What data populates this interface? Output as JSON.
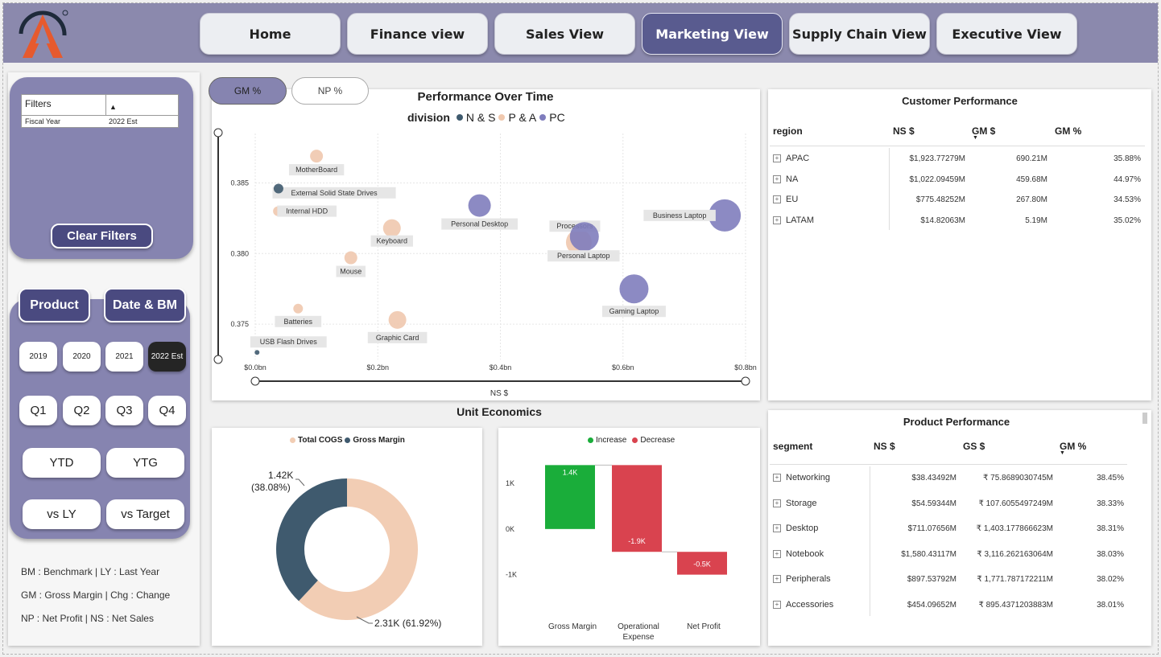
{
  "nav": {
    "items": [
      {
        "label": "Home",
        "active": false
      },
      {
        "label": "Finance view",
        "active": false
      },
      {
        "label": "Sales View",
        "active": false
      },
      {
        "label": "Marketing View",
        "active": true
      },
      {
        "label": "Supply Chain View",
        "active": false
      },
      {
        "label": "Executive View",
        "active": false
      }
    ]
  },
  "filters": {
    "header": "Filters",
    "row_label": "Fiscal Year",
    "row_value": "2022 Est",
    "clear_label": "Clear Filters"
  },
  "tabs": {
    "product": "Product",
    "date_bm": "Date & BM"
  },
  "years": [
    "2019",
    "2020",
    "2021",
    "2022 Est"
  ],
  "quarters": [
    "Q1",
    "Q2",
    "Q3",
    "Q4"
  ],
  "ytd": "YTD",
  "ytg": "YTG",
  "vs_ly": "vs LY",
  "vs_target": "vs Target",
  "legend_notes": [
    "BM : Benchmark | LY : Last Year",
    "GM : Gross Margin |  Chg : Change",
    "NP : Net Profit | NS : Net Sales"
  ],
  "metric_toggle": {
    "gm": "GM %",
    "np": "NP %"
  },
  "colors": {
    "ns": "#3f5a6e",
    "pa": "#f0c8ae",
    "pc": "#7f7dbd",
    "increase": "#1aad3a",
    "decrease": "#d9434f",
    "cogs": "#f2cdb4",
    "gm": "#3f5a6e",
    "accent": "#595b8f"
  },
  "chart_data": [
    {
      "type": "scatter",
      "title": "Performance Over Time",
      "legend_title": "division",
      "legend": [
        "N & S",
        "P & A",
        "PC"
      ],
      "xlabel": "NS $",
      "xlim": [
        0,
        0.8
      ],
      "ylim": [
        0.3725,
        0.3885
      ],
      "x_ticks": [
        "$0.0bn",
        "$0.2bn",
        "$0.4bn",
        "$0.6bn",
        "$0.8bn"
      ],
      "y_ticks": [
        "0.375",
        "0.380",
        "0.385"
      ],
      "points": [
        {
          "label": "MotherBoard",
          "division": "P & A",
          "x": 0.1,
          "y": 0.3869
        },
        {
          "label": "External Solid State Drives",
          "division": "N & S",
          "x": 0.05,
          "y": 0.3843
        },
        {
          "label": "",
          "division": "N & S",
          "x": 0.038,
          "y": 0.3846
        },
        {
          "label": "Internal HDD",
          "division": "P & A",
          "x": 0.037,
          "y": 0.383
        },
        {
          "label": "Personal Desktop",
          "division": "PC",
          "x": 0.366,
          "y": 0.3834
        },
        {
          "label": "Keyboard",
          "division": "P & A",
          "x": 0.223,
          "y": 0.3818
        },
        {
          "label": "Mouse",
          "division": "P & A",
          "x": 0.156,
          "y": 0.3797
        },
        {
          "label": "Processors",
          "division": "P & A",
          "x": 0.528,
          "y": 0.3808
        },
        {
          "label": "Personal Laptop",
          "division": "PC",
          "x": 0.537,
          "y": 0.3812
        },
        {
          "label": "Business Laptop",
          "division": "PC",
          "x": 0.766,
          "y": 0.3827
        },
        {
          "label": "Gaming Laptop",
          "division": "PC",
          "x": 0.618,
          "y": 0.3775
        },
        {
          "label": "Batteries",
          "division": "P & A",
          "x": 0.07,
          "y": 0.3761
        },
        {
          "label": "Graphic Card",
          "division": "P & A",
          "x": 0.232,
          "y": 0.3753
        },
        {
          "label": "USB Flash Drives",
          "division": "N & S",
          "x": 0.003,
          "y": 0.373
        }
      ]
    },
    {
      "type": "pie",
      "title": "Unit Economics",
      "legend": [
        "Total COGS",
        "Gross Margin"
      ],
      "slices": [
        {
          "name": "Total COGS",
          "value": 2.31,
          "label": "2.31K (61.92%)"
        },
        {
          "name": "Gross Margin",
          "value": 1.42,
          "label": "1.42K",
          "pct": "(38.08%)"
        }
      ]
    },
    {
      "type": "bar",
      "subtype": "waterfall",
      "legend": [
        "Increase",
        "Decrease"
      ],
      "categories": [
        "Gross Margin",
        "Operational Expense",
        "Net Profit"
      ],
      "values": [
        1.4,
        -1.9,
        -0.5
      ],
      "value_labels": [
        "1.4K",
        "-1.9K",
        "-0.5K"
      ],
      "y_ticks": [
        "1K",
        "0K",
        "-1K"
      ],
      "ylim": [
        -1.5,
        1.6
      ]
    }
  ],
  "customer_performance": {
    "title": "Customer Performance",
    "headers": [
      "region",
      "NS $",
      "GM $",
      "GM %"
    ],
    "rows": [
      [
        "APAC",
        "$1,923.77279M",
        "690.21M",
        "35.88%"
      ],
      [
        "NA",
        "$1,022.09459M",
        "459.68M",
        "44.97%"
      ],
      [
        "EU",
        "$775.48252M",
        "267.80M",
        "34.53%"
      ],
      [
        "LATAM",
        "$14.82063M",
        "5.19M",
        "35.02%"
      ]
    ]
  },
  "product_performance": {
    "title": "Product Performance",
    "headers": [
      "segment",
      "NS $",
      "GS $",
      "GM %"
    ],
    "rows": [
      [
        "Networking",
        "$38.43492M",
        "₹ 75.8689030745M",
        "38.45%"
      ],
      [
        "Storage",
        "$54.59344M",
        "₹ 107.6055497249M",
        "38.33%"
      ],
      [
        "Desktop",
        "$711.07656M",
        "₹ 1,403.177866623M",
        "38.31%"
      ],
      [
        "Notebook",
        "$1,580.43117M",
        "₹ 3,116.262163064M",
        "38.03%"
      ],
      [
        "Peripherals",
        "$897.53792M",
        "₹ 1,771.787172211M",
        "38.02%"
      ],
      [
        "Accessories",
        "$454.09652M",
        "₹ 895.4371203883M",
        "38.01%"
      ]
    ]
  }
}
